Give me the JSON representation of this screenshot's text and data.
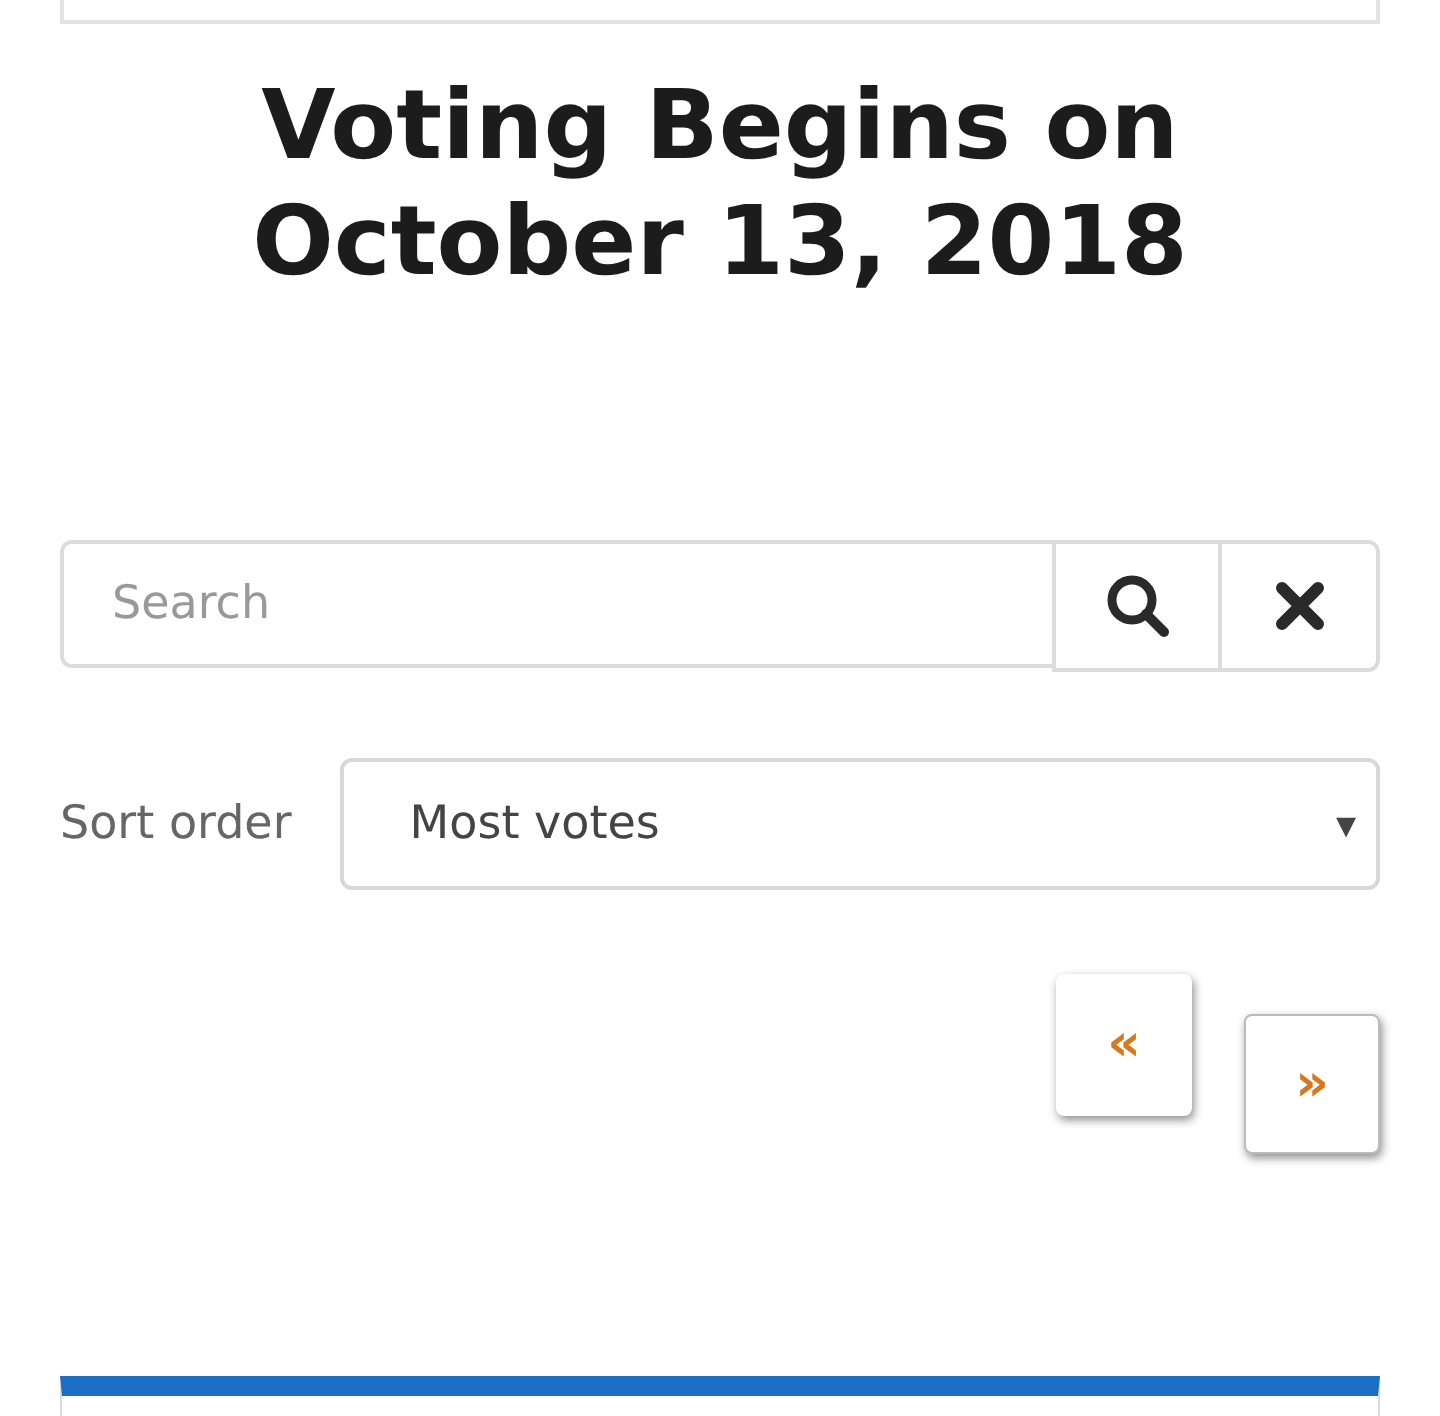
{
  "heading": "Voting Begins on October 13, 2018",
  "search": {
    "placeholder": "Search"
  },
  "sort": {
    "label": "Sort order",
    "value": "Most votes",
    "arrow": "▾"
  },
  "pagination": [
    {
      "label": "«"
    },
    {
      "label": "»"
    }
  ]
}
